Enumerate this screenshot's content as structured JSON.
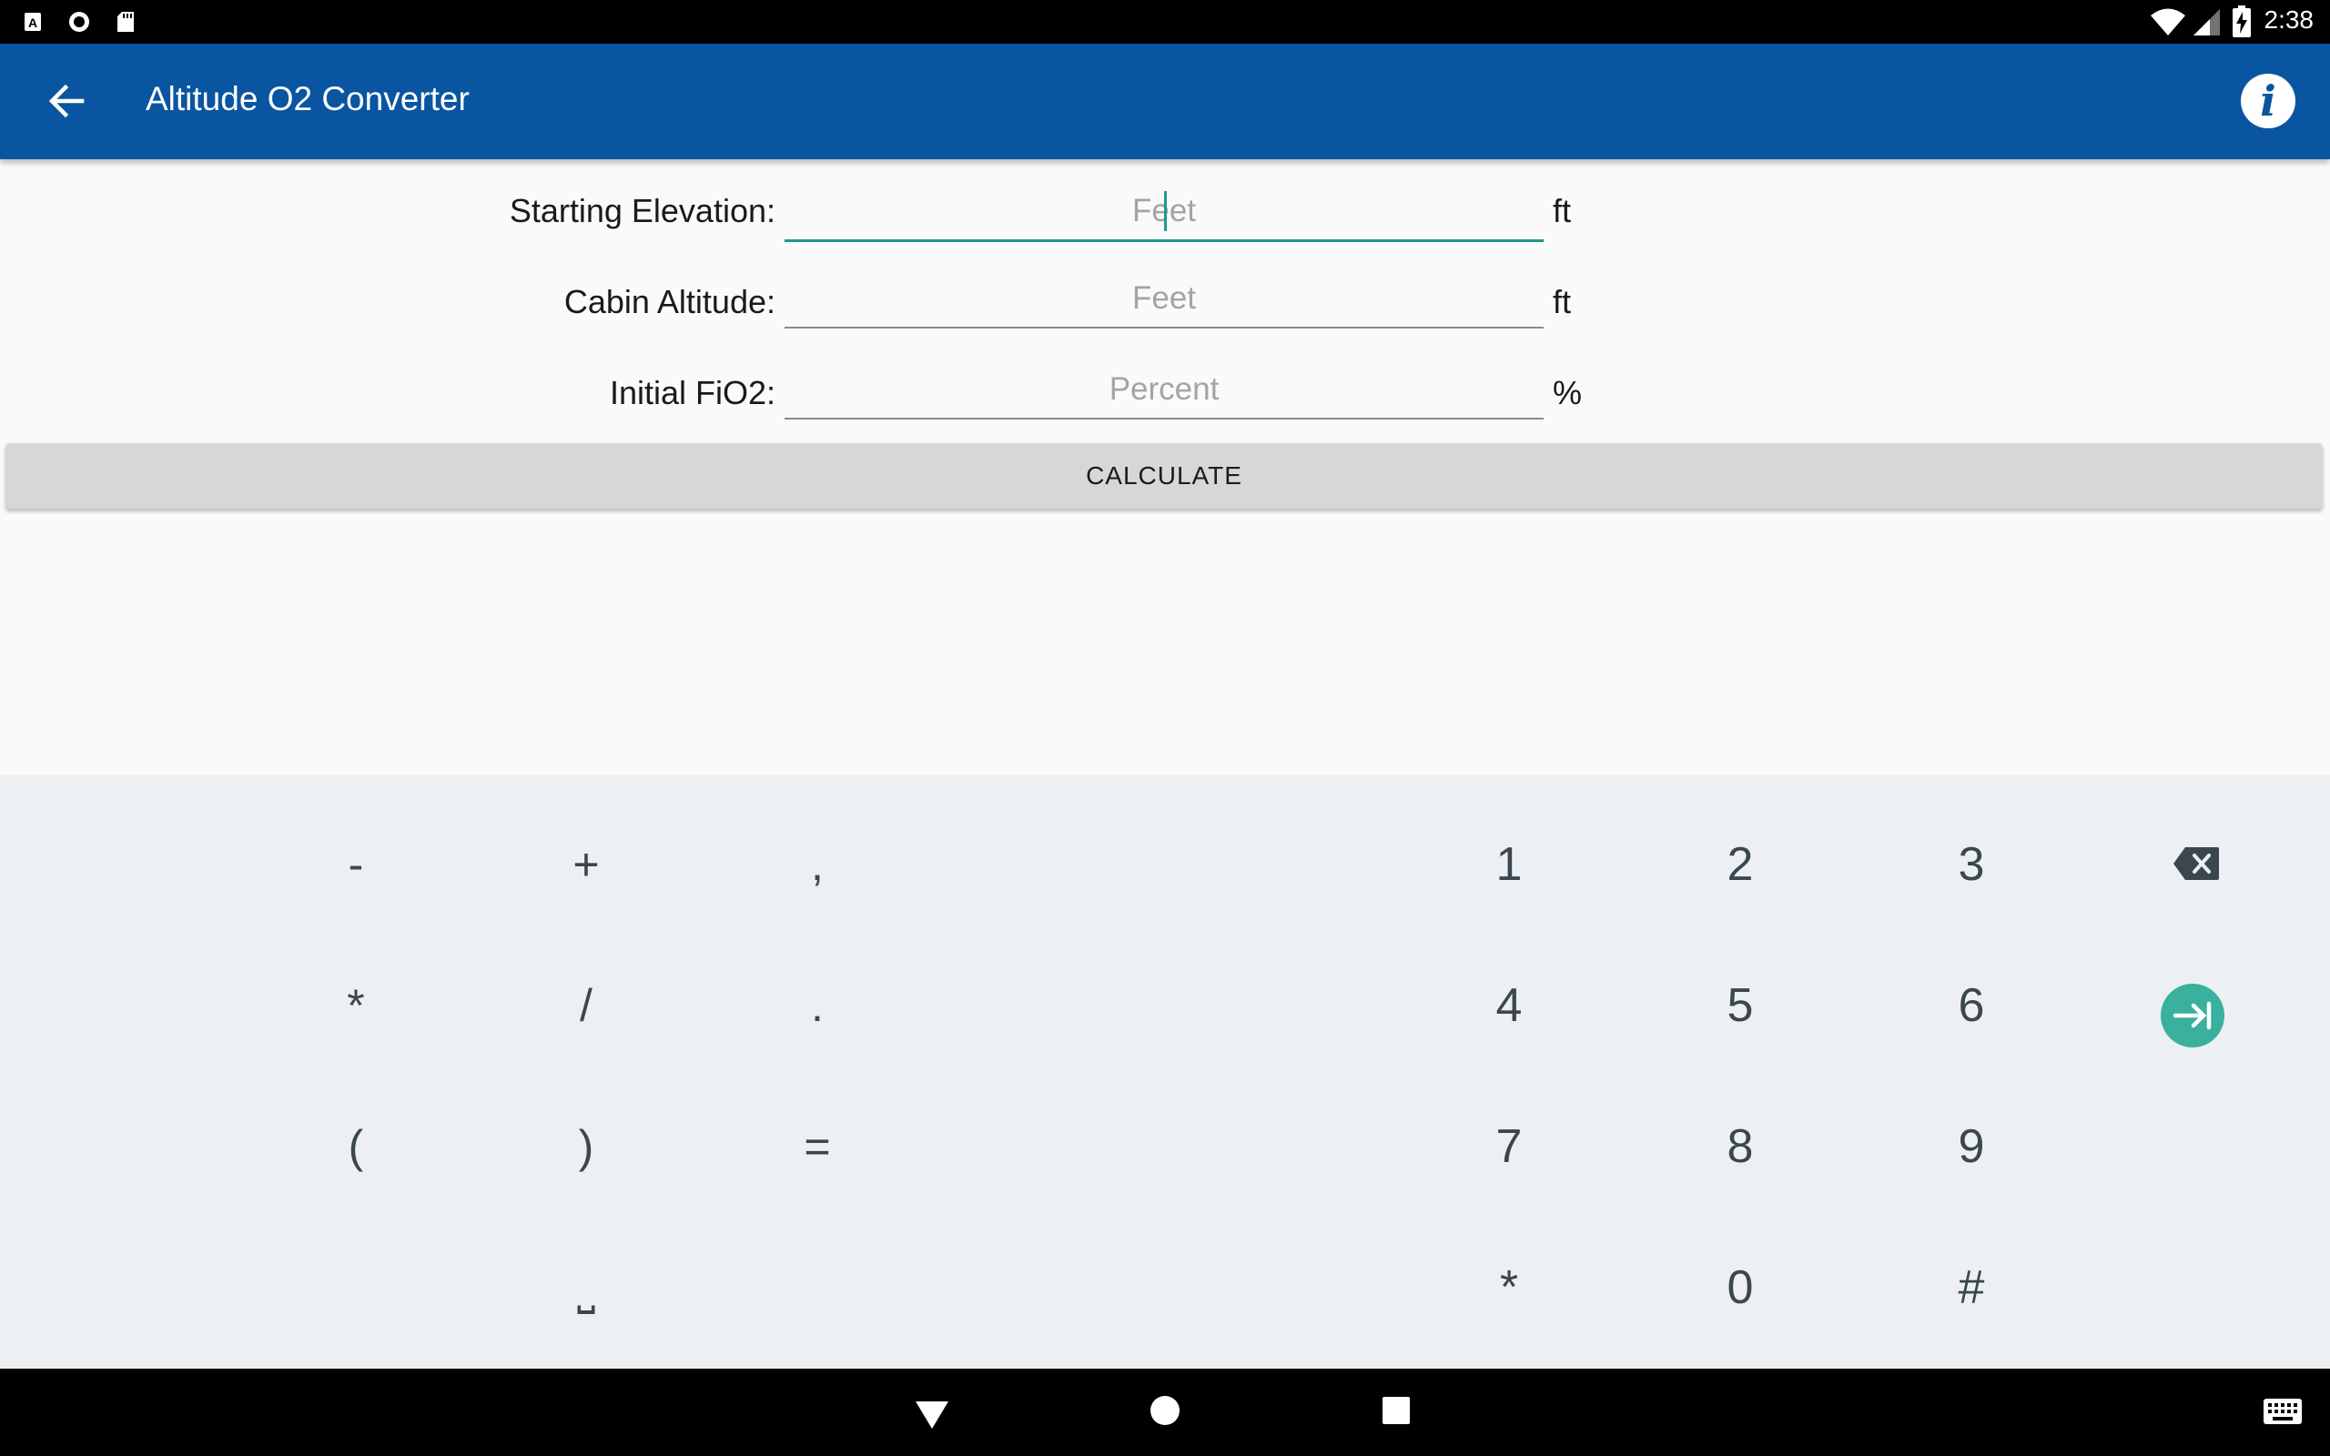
{
  "status_bar": {
    "time": "2:38",
    "left_icons": [
      "a-box-icon",
      "circle-record-icon",
      "sd-card-icon"
    ],
    "right_icons": [
      "wifi-icon",
      "signal-icon",
      "battery-charging-icon"
    ]
  },
  "app_bar": {
    "title": "Altitude O2 Converter",
    "back_icon": "arrow-back-icon",
    "info_glyph": "i",
    "color": "#0a55a1"
  },
  "form": {
    "fields": [
      {
        "label": "Starting Elevation:",
        "placeholder": "Feet",
        "value": "",
        "unit": "ft",
        "focused": true
      },
      {
        "label": "Cabin Altitude:",
        "placeholder": "Feet",
        "value": "",
        "unit": "ft",
        "focused": false
      },
      {
        "label": "Initial FiO2:",
        "placeholder": "Percent",
        "value": "",
        "unit": "%",
        "focused": false
      }
    ],
    "calculate_label": "CALCULATE",
    "accent_color": "#20998c"
  },
  "keyboard": {
    "symbol_keys": [
      "-",
      "+",
      ",",
      "*",
      "/",
      ".",
      "(",
      ")",
      "="
    ],
    "space_glyph": "⎵",
    "number_keys": [
      "1",
      "2",
      "3",
      "4",
      "5",
      "6",
      "7",
      "8",
      "9",
      "*",
      "0",
      "#"
    ],
    "action_icons": [
      "backspace-icon",
      "tab-next-icon"
    ],
    "action_color": "#3ab09e"
  },
  "nav_bar": {
    "icons": [
      "nav-back-icon",
      "nav-home-icon",
      "nav-recents-icon",
      "keyboard-switch-icon"
    ]
  }
}
